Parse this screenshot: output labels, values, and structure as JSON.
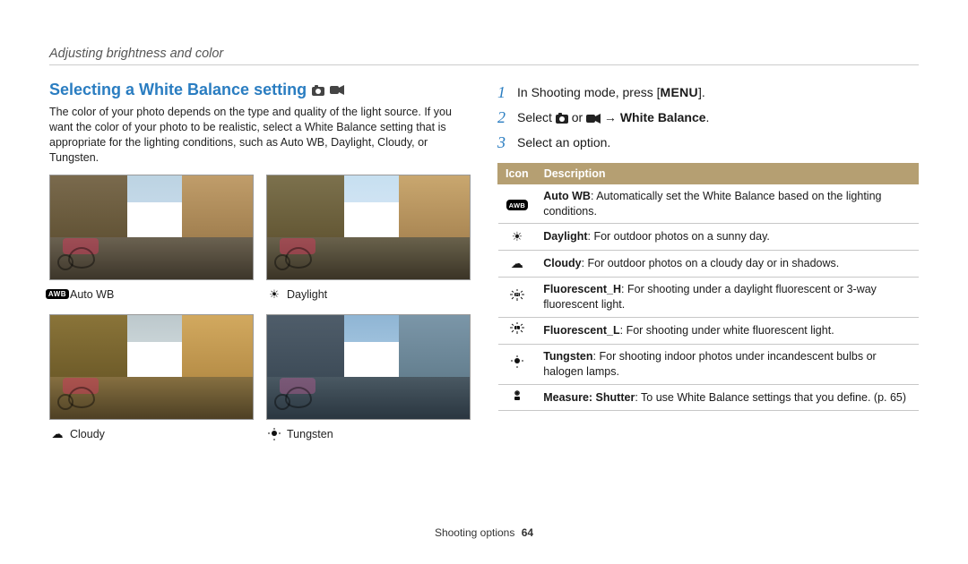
{
  "breadcrumb": "Adjusting brightness and color",
  "section_title": "Selecting a White Balance setting",
  "intro_text": "The color of your photo depends on the type and quality of the light source. If you want the color of your photo to be realistic, select a White Balance setting that is appropriate for the lighting conditions, such as Auto WB, Daylight, Cloudy, or Tungsten.",
  "thumbs": {
    "auto_wb": {
      "label": "Auto WB",
      "icon": "awb"
    },
    "daylight": {
      "label": "Daylight",
      "icon": "sun"
    },
    "cloudy": {
      "label": "Cloudy",
      "icon": "cloud"
    },
    "tungsten": {
      "label": "Tungsten",
      "icon": "bulb"
    }
  },
  "steps": {
    "s1_prefix": "In Shooting mode, press [",
    "s1_menu": "MENU",
    "s1_suffix": "].",
    "s2_prefix": "Select ",
    "s2_or": " or ",
    "s2_arrow": " → ",
    "s2_wb": "White Balance",
    "s2_suffix": ".",
    "s3": "Select an option."
  },
  "table": {
    "headers": {
      "icon": "Icon",
      "desc": "Description"
    },
    "rows": [
      {
        "bold": "Auto WB",
        "text": ": Automatically set the White Balance based on the lighting conditions."
      },
      {
        "bold": "Daylight",
        "text": ": For outdoor photos on a sunny day."
      },
      {
        "bold": "Cloudy",
        "text": ": For outdoor photos on a cloudy day or in shadows."
      },
      {
        "bold": "Fluorescent_H",
        "text": ": For shooting under a daylight fluorescent or 3-way fluorescent light."
      },
      {
        "bold": "Fluorescent_L",
        "text": ": For shooting under white fluorescent light."
      },
      {
        "bold": "Tungsten",
        "text": ": For shooting indoor photos under incandescent bulbs or halogen lamps."
      },
      {
        "bold": "Measure: Shutter",
        "text": ": To use White Balance settings that you define. (p. 65)"
      }
    ]
  },
  "footer": {
    "label": "Shooting options",
    "page": "64"
  }
}
